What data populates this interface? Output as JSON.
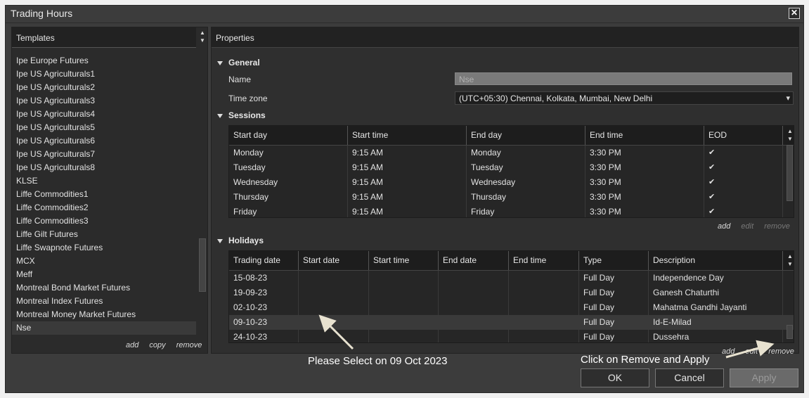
{
  "window": {
    "title": "Trading Hours"
  },
  "templates": {
    "header": "Templates",
    "items": [
      "Ipe Europe Futures",
      "Ipe US Agriculturals1",
      "Ipe US Agriculturals2",
      "Ipe US Agriculturals3",
      "Ipe US Agriculturals4",
      "Ipe US Agriculturals5",
      "Ipe US Agriculturals6",
      "Ipe US Agriculturals7",
      "Ipe US Agriculturals8",
      "KLSE",
      "Liffe Commodities1",
      "Liffe Commodities2",
      "Liffe Commodities3",
      "Liffe Gilt Futures",
      "Liffe Swapnote Futures",
      "MCX",
      "Meff",
      "Montreal Bond Market Futures",
      "Montreal Index Futures",
      "Montreal Money Market Futures",
      "Nse"
    ],
    "selected": "Nse",
    "actions": {
      "add": "add",
      "copy": "copy",
      "remove": "remove"
    }
  },
  "properties": {
    "header": "Properties",
    "general": {
      "title": "General",
      "name_label": "Name",
      "name_value": "Nse",
      "timezone_label": "Time zone",
      "timezone_value": "(UTC+05:30) Chennai, Kolkata, Mumbai, New Delhi"
    },
    "sessions": {
      "title": "Sessions",
      "columns": [
        "Start day",
        "Start time",
        "End day",
        "End time",
        "EOD"
      ],
      "rows": [
        [
          "Monday",
          "9:15 AM",
          "Monday",
          "3:30 PM",
          "✔"
        ],
        [
          "Tuesday",
          "9:15 AM",
          "Tuesday",
          "3:30 PM",
          "✔"
        ],
        [
          "Wednesday",
          "9:15 AM",
          "Wednesday",
          "3:30 PM",
          "✔"
        ],
        [
          "Thursday",
          "9:15 AM",
          "Thursday",
          "3:30 PM",
          "✔"
        ],
        [
          "Friday",
          "9:15 AM",
          "Friday",
          "3:30 PM",
          "✔"
        ]
      ],
      "actions": {
        "add": "add",
        "edit": "edit",
        "remove": "remove"
      }
    },
    "holidays": {
      "title": "Holidays",
      "columns": [
        "Trading date",
        "Start date",
        "Start time",
        "End date",
        "End time",
        "Type",
        "Description"
      ],
      "rows": [
        [
          "15-08-23",
          "",
          "",
          "",
          "",
          "Full Day",
          "Independence Day"
        ],
        [
          "19-09-23",
          "",
          "",
          "",
          "",
          "Full Day",
          "Ganesh Chaturthi"
        ],
        [
          "02-10-23",
          "",
          "",
          "",
          "",
          "Full Day",
          "Mahatma Gandhi Jayanti"
        ],
        [
          "09-10-23",
          "",
          "",
          "",
          "",
          "Full Day",
          "Id-E-Milad"
        ],
        [
          "24-10-23",
          "",
          "",
          "",
          "",
          "Full Day",
          "Dussehra"
        ]
      ],
      "selected_row": "09-10-23",
      "actions": {
        "add": "add",
        "edit": "edit",
        "remove": "remove"
      }
    }
  },
  "buttons": {
    "ok": "OK",
    "cancel": "Cancel",
    "apply": "Apply"
  },
  "annotations": {
    "select_hint": "Please Select on 09 Oct 2023",
    "remove_hint": "Click on Remove and Apply"
  },
  "colors": {
    "window_bg": "#3c3c3c",
    "panel_bg": "#2b2b2b",
    "selected_row": "#3a3a3a",
    "annotation_text": "#ffffff"
  }
}
